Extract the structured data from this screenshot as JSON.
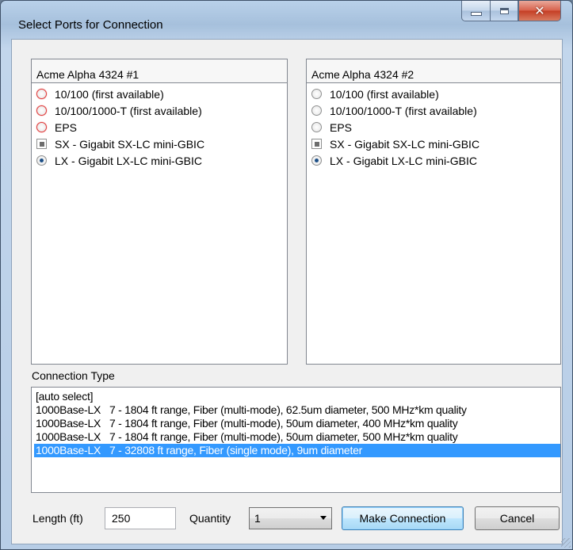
{
  "window": {
    "title": "Select Ports for Connection"
  },
  "left_panel": {
    "header": "Acme Alpha 4324 #1",
    "options": [
      "10/100 (first available)",
      "10/100/1000-T (first available)",
      "EPS",
      "SX - Gigabit SX-LC mini-GBIC",
      "LX - Gigabit LX-LC mini-GBIC"
    ],
    "selected": "LX - Gigabit LX-LC mini-GBIC"
  },
  "right_panel": {
    "header": "Acme Alpha 4324 #2",
    "options": [
      "10/100 (first available)",
      "10/100/1000-T (first available)",
      "EPS",
      "SX - Gigabit SX-LC mini-GBIC",
      "LX - Gigabit LX-LC mini-GBIC"
    ],
    "selected": "LX - Gigabit LX-LC mini-GBIC"
  },
  "connection_type": {
    "label": "Connection Type",
    "items": [
      "[auto select]",
      "1000Base-LX   7 - 1804 ft range, Fiber (multi-mode), 62.5um diameter, 500 MHz*km quality",
      "1000Base-LX   7 - 1804 ft range, Fiber (multi-mode), 50um diameter, 400 MHz*km quality",
      "1000Base-LX   7 - 1804 ft range, Fiber (multi-mode), 50um diameter, 500 MHz*km quality",
      "1000Base-LX   7 - 32808 ft range, Fiber (single mode), 9um diameter"
    ],
    "selected": "1000Base-LX   7 - 32808 ft range, Fiber (single mode), 9um diameter"
  },
  "length": {
    "label": "Length (ft)",
    "value": "250"
  },
  "quantity": {
    "label": "Quantity",
    "value": "1"
  },
  "buttons": {
    "make_connection": "Make Connection",
    "cancel": "Cancel"
  },
  "colors": {
    "selection": "#3399ff",
    "unavailable_radio": "#e03b3b",
    "title_bar": "#b9d1ea"
  },
  "icons": [
    "minimize-icon",
    "maximize-icon",
    "close-icon",
    "dropdown-arrow-icon",
    "resize-grip-icon"
  ]
}
